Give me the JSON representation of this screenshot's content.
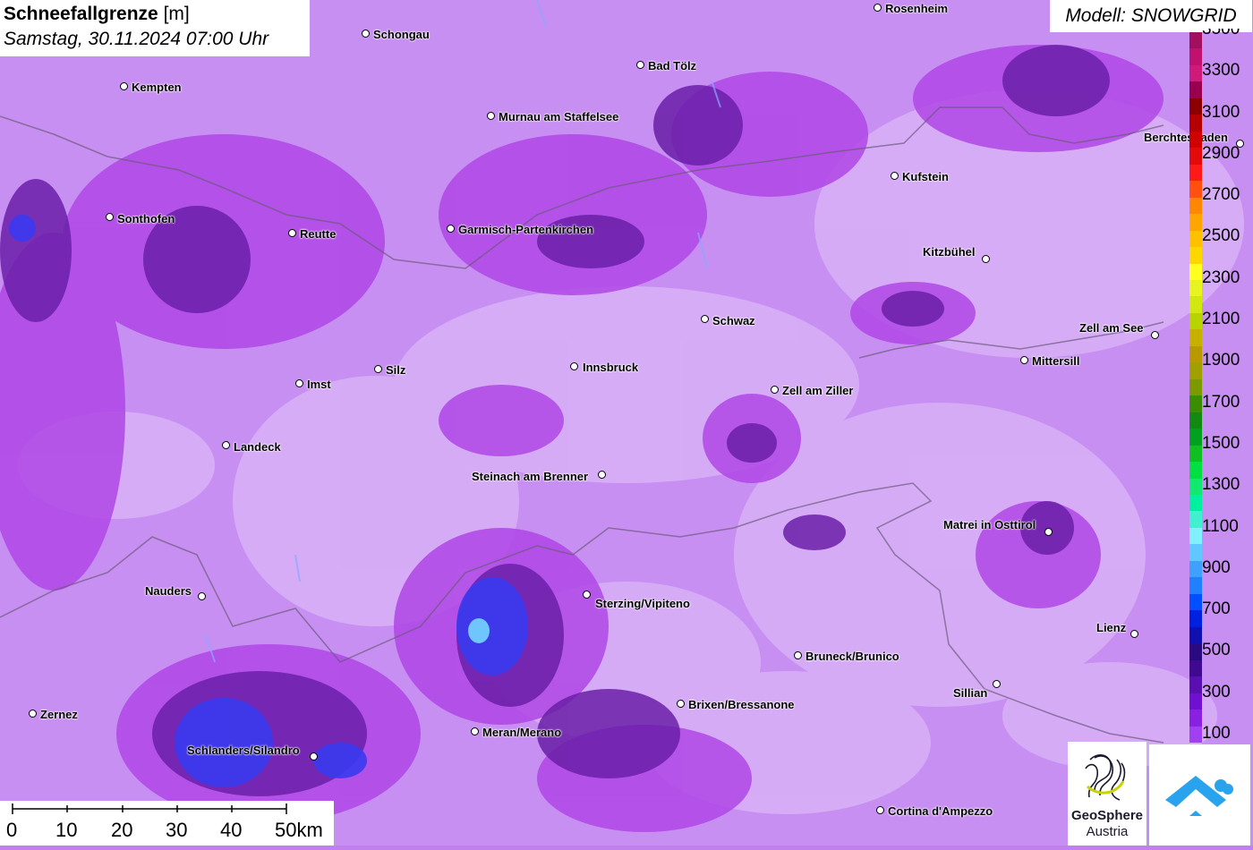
{
  "title": {
    "main": "Schneefallgrenze",
    "unit": "[m]",
    "datetime": "Samstag, 30.11.2024 07:00 Uhr"
  },
  "model": "Modell: SNOWGRID",
  "places": [
    {
      "name": "Rosenheim"
    },
    {
      "name": "Schongau"
    },
    {
      "name": "Kempten"
    },
    {
      "name": "Bad Tölz"
    },
    {
      "name": "Murnau am Staffelsee"
    },
    {
      "name": "Berchtesgaden"
    },
    {
      "name": "Kufstein"
    },
    {
      "name": "Sonthofen"
    },
    {
      "name": "Reutte"
    },
    {
      "name": "Garmisch-Partenkirchen"
    },
    {
      "name": "Kitzbühel"
    },
    {
      "name": "Schwaz"
    },
    {
      "name": "Zell am See"
    },
    {
      "name": "Mittersill"
    },
    {
      "name": "Innsbruck"
    },
    {
      "name": "Silz"
    },
    {
      "name": "Imst"
    },
    {
      "name": "Zell am Ziller"
    },
    {
      "name": "Landeck"
    },
    {
      "name": "Steinach am Brenner"
    },
    {
      "name": "Matrei in Osttirol"
    },
    {
      "name": "Nauders"
    },
    {
      "name": "Sterzing/Vipiteno"
    },
    {
      "name": "Lienz"
    },
    {
      "name": "Bruneck/Brunico"
    },
    {
      "name": "Sillian"
    },
    {
      "name": "Brixen/Bressanone"
    },
    {
      "name": "Zernez"
    },
    {
      "name": "Meran/Merano"
    },
    {
      "name": "Schlanders/Silandro"
    },
    {
      "name": "Cortina d'Ampezzo"
    }
  ],
  "legend": {
    "labels": [
      "3500",
      "3300",
      "3100",
      "2900",
      "2700",
      "2500",
      "2300",
      "2100",
      "1900",
      "1700",
      "1500",
      "1300",
      "1100",
      "900",
      "700",
      "500",
      "300",
      "100"
    ],
    "colors": [
      "#a0105f",
      "#c01070",
      "#d01a7a",
      "#9a0050",
      "#8a0000",
      "#b40000",
      "#d00000",
      "#e20a0a",
      "#ff1a1a",
      "#ff5010",
      "#ff8800",
      "#ffa500",
      "#ffc000",
      "#ffd700",
      "#ffff20",
      "#e8f420",
      "#d0e810",
      "#b8d400",
      "#c8b000",
      "#b89a00",
      "#a0a000",
      "#7a9a00",
      "#3a8c00",
      "#108a10",
      "#00a020",
      "#10c020",
      "#00e040",
      "#10e870",
      "#00f0a0",
      "#40f0d0",
      "#80f0ff",
      "#60c8ff",
      "#40a0ff",
      "#2080ff",
      "#0050ff",
      "#0020e0",
      "#1010b0",
      "#2a0a80",
      "#400a90",
      "#5a10b0",
      "#7010d0",
      "#8a20e0",
      "#a040f0"
    ]
  },
  "scale": {
    "ticks": [
      "0",
      "10",
      "20",
      "30",
      "40",
      "50km"
    ]
  },
  "logos": {
    "geosphere_line1": "GeoSphere",
    "geosphere_line2": "Austria"
  }
}
